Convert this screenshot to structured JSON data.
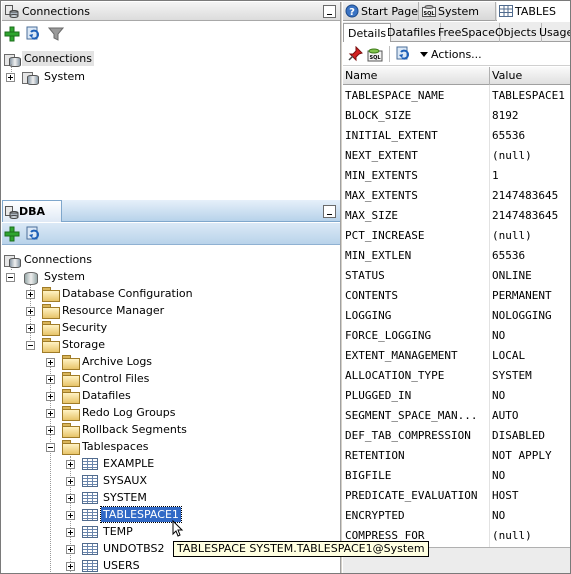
{
  "connections_panel": {
    "title": "Connections",
    "tree": [
      {
        "label": "Connections",
        "level": 0
      },
      {
        "label": "System",
        "level": 1
      }
    ]
  },
  "dba_panel": {
    "title": "DBA",
    "tree": {
      "root": "Connections",
      "system": "System",
      "items": [
        "Database Configuration",
        "Resource Manager",
        "Security",
        "Storage"
      ],
      "storage_items": [
        "Archive Logs",
        "Control Files",
        "Datafiles",
        "Redo Log Groups",
        "Rollback Segments",
        "Tablespaces"
      ],
      "tablespaces": [
        "EXAMPLE",
        "SYSAUX",
        "SYSTEM",
        "TABLESPACE1",
        "TEMP",
        "UNDOTBS2",
        "USERS"
      ]
    },
    "tooltip": "TABLESPACE SYSTEM.TABLESPACE1@System"
  },
  "editor_tabs": [
    {
      "label": "Start Page",
      "icon": "help-icon"
    },
    {
      "label": "System",
      "icon": "sql-icon"
    },
    {
      "label": "TABLES",
      "icon": "table-icon"
    }
  ],
  "detail_tabs": [
    "Details",
    "Datafiles",
    "FreeSpace",
    "Objects",
    "Usage"
  ],
  "actions_label": "Actions...",
  "grid": {
    "headers": [
      "Name",
      "Value"
    ],
    "rows": [
      [
        "TABLESPACE_NAME",
        "TABLESPACE1"
      ],
      [
        "BLOCK_SIZE",
        "8192"
      ],
      [
        "INITIAL_EXTENT",
        "65536"
      ],
      [
        "NEXT_EXTENT",
        "(null)"
      ],
      [
        "MIN_EXTENTS",
        "1"
      ],
      [
        "MAX_EXTENTS",
        "2147483645"
      ],
      [
        "MAX_SIZE",
        "2147483645"
      ],
      [
        "PCT_INCREASE",
        "(null)"
      ],
      [
        "MIN_EXTLEN",
        "65536"
      ],
      [
        "STATUS",
        "ONLINE"
      ],
      [
        "CONTENTS",
        "PERMANENT"
      ],
      [
        "LOGGING",
        "NOLOGGING"
      ],
      [
        "FORCE_LOGGING",
        "NO"
      ],
      [
        "EXTENT_MANAGEMENT",
        "LOCAL"
      ],
      [
        "ALLOCATION_TYPE",
        "SYSTEM"
      ],
      [
        "PLUGGED_IN",
        "NO"
      ],
      [
        "SEGMENT_SPACE_MAN...",
        "AUTO"
      ],
      [
        "DEF_TAB_COMPRESSION",
        "DISABLED"
      ],
      [
        "RETENTION",
        "NOT APPLY"
      ],
      [
        "BIGFILE",
        "NO"
      ],
      [
        "PREDICATE_EVALUATION",
        "HOST"
      ],
      [
        "ENCRYPTED",
        "NO"
      ],
      [
        "COMPRESS_FOR",
        "(null)"
      ]
    ]
  },
  "colors": {
    "selection": "#3169c6",
    "dba_header": "#b7d2ea",
    "tooltip_bg": "#ffffe1"
  }
}
